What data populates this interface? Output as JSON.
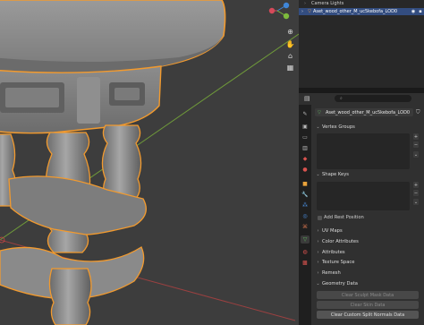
{
  "outliner": {
    "rows": [
      {
        "label": "Camera Lights",
        "selected": false
      },
      {
        "label": "Aset_wood_other_M_uc5kebofa_LOD0",
        "selected": true
      }
    ]
  },
  "viewport_tools": [
    "grab-hand-icon",
    "zoom-icon",
    "camera-icon",
    "grid-icon"
  ],
  "properties": {
    "object_name": "Aset_wood_other_M_uc5kebofa_LOD0",
    "panels": {
      "vertex_groups": "Vertex Groups",
      "shape_keys": "Shape Keys",
      "add_rest_position": "Add Rest Position",
      "uv_maps": "UV Maps",
      "color_attributes": "Color Attributes",
      "attributes": "Attributes",
      "texture_space": "Texture Space",
      "remesh": "Remesh",
      "geometry_data": "Geometry Data"
    },
    "buttons": {
      "clear_sculpt": "Clear Sculpt Mask Data",
      "clear_skin": "Clear Skin Data",
      "clear_normals": "Clear Custom Split Normals Data"
    }
  },
  "colors": {
    "selection_outline": "#f29a2e",
    "active_row": "#334d80"
  }
}
